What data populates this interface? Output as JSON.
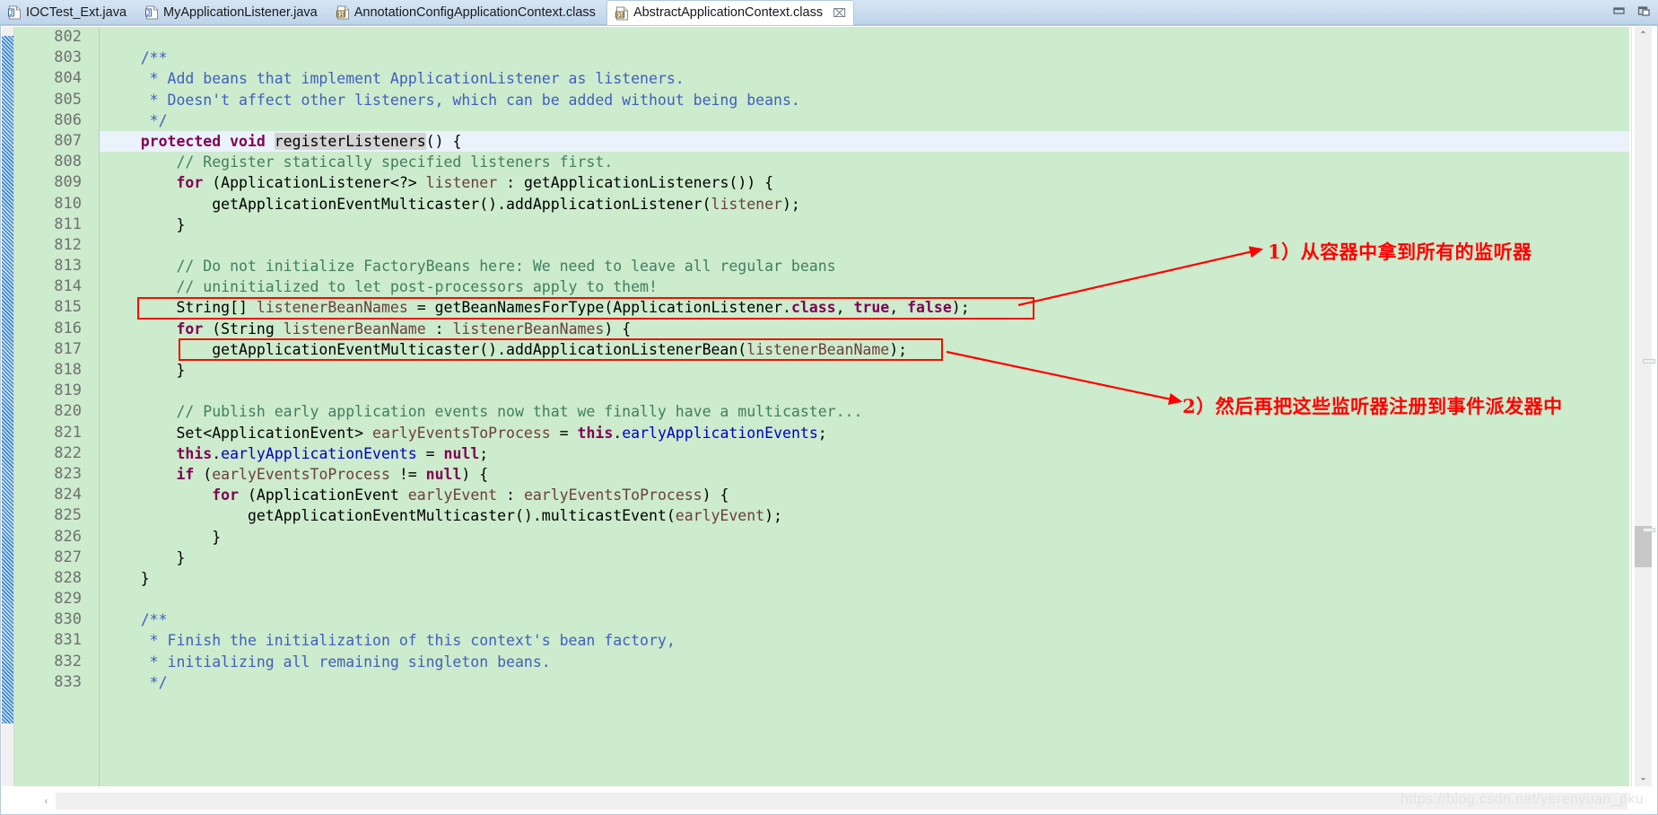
{
  "window": {
    "minimize_label": "minimize-window",
    "restore_label": "restore-window"
  },
  "tabs": [
    {
      "label": "IOCTest_Ext.java",
      "icon": "java-file-icon",
      "active": false,
      "closable": false
    },
    {
      "label": "MyApplicationListener.java",
      "icon": "java-file-icon",
      "active": false,
      "closable": false
    },
    {
      "label": "AnnotationConfigApplicationContext.class",
      "icon": "class-file-icon",
      "active": false,
      "closable": false
    },
    {
      "label": "AbstractApplicationContext.class",
      "icon": "class-file-icon",
      "active": true,
      "closable": true,
      "close_glyph": "⌧"
    }
  ],
  "editor": {
    "first_line": 802,
    "current_line": 807,
    "fold_lines": [
      803,
      807,
      830
    ],
    "lines": [
      {
        "n": 802,
        "tokens": []
      },
      {
        "n": 803,
        "tokens": [
          {
            "t": "    /**",
            "c": "jd"
          }
        ]
      },
      {
        "n": 804,
        "tokens": [
          {
            "t": "     * Add beans that implement ApplicationListener as listeners.",
            "c": "jd"
          }
        ]
      },
      {
        "n": 805,
        "tokens": [
          {
            "t": "     * Doesn't affect other listeners, which can be added without being beans.",
            "c": "jd"
          }
        ]
      },
      {
        "n": 806,
        "tokens": [
          {
            "t": "     */",
            "c": "jd"
          }
        ]
      },
      {
        "n": 807,
        "tokens": [
          {
            "t": "    ",
            "c": "pl"
          },
          {
            "t": "protected void ",
            "c": "k"
          },
          {
            "t": "registerListeners",
            "c": "pl occ"
          },
          {
            "t": "() {",
            "c": "pl"
          }
        ]
      },
      {
        "n": 808,
        "tokens": [
          {
            "t": "        // Register statically specified listeners first.",
            "c": "cm"
          }
        ]
      },
      {
        "n": 809,
        "tokens": [
          {
            "t": "        ",
            "c": "pl"
          },
          {
            "t": "for",
            "c": "k"
          },
          {
            "t": " (ApplicationListener<?> ",
            "c": "pl"
          },
          {
            "t": "listener",
            "c": "lv"
          },
          {
            "t": " : getApplicationListeners()) {",
            "c": "pl"
          }
        ]
      },
      {
        "n": 810,
        "tokens": [
          {
            "t": "            getApplicationEventMulticaster().addApplicationListener(",
            "c": "pl"
          },
          {
            "t": "listener",
            "c": "lv"
          },
          {
            "t": ");",
            "c": "pl"
          }
        ]
      },
      {
        "n": 811,
        "tokens": [
          {
            "t": "        }",
            "c": "pl"
          }
        ]
      },
      {
        "n": 812,
        "tokens": []
      },
      {
        "n": 813,
        "tokens": [
          {
            "t": "        // Do not initialize FactoryBeans here: We need to leave all regular beans",
            "c": "cm"
          }
        ]
      },
      {
        "n": 814,
        "tokens": [
          {
            "t": "        // uninitialized to let post-processors apply to them!",
            "c": "cm"
          }
        ]
      },
      {
        "n": 815,
        "tokens": [
          {
            "t": "        String[] ",
            "c": "pl"
          },
          {
            "t": "listenerBeanNames",
            "c": "lv"
          },
          {
            "t": " = getBeanNamesForType(ApplicationListener.",
            "c": "pl"
          },
          {
            "t": "class",
            "c": "k"
          },
          {
            "t": ", ",
            "c": "pl"
          },
          {
            "t": "true",
            "c": "k"
          },
          {
            "t": ", ",
            "c": "pl"
          },
          {
            "t": "false",
            "c": "k"
          },
          {
            "t": ");",
            "c": "pl"
          }
        ]
      },
      {
        "n": 816,
        "tokens": [
          {
            "t": "        ",
            "c": "pl"
          },
          {
            "t": "for",
            "c": "k"
          },
          {
            "t": " (String ",
            "c": "pl"
          },
          {
            "t": "listenerBeanName",
            "c": "lv"
          },
          {
            "t": " : ",
            "c": "pl"
          },
          {
            "t": "listenerBeanNames",
            "c": "lv"
          },
          {
            "t": ") {",
            "c": "pl"
          }
        ]
      },
      {
        "n": 817,
        "tokens": [
          {
            "t": "            getApplicationEventMulticaster().addApplicationListenerBean(",
            "c": "pl"
          },
          {
            "t": "listenerBeanName",
            "c": "lv"
          },
          {
            "t": ");",
            "c": "pl"
          }
        ]
      },
      {
        "n": 818,
        "tokens": [
          {
            "t": "        }",
            "c": "pl"
          }
        ]
      },
      {
        "n": 819,
        "tokens": []
      },
      {
        "n": 820,
        "tokens": [
          {
            "t": "        // Publish early application events now that we finally have a multicaster...",
            "c": "cm"
          }
        ]
      },
      {
        "n": 821,
        "tokens": [
          {
            "t": "        Set<ApplicationEvent> ",
            "c": "pl"
          },
          {
            "t": "earlyEventsToProcess",
            "c": "lv"
          },
          {
            "t": " = ",
            "c": "pl"
          },
          {
            "t": "this",
            "c": "k"
          },
          {
            "t": ".",
            "c": "pl"
          },
          {
            "t": "earlyApplicationEvents",
            "c": "fld"
          },
          {
            "t": ";",
            "c": "pl"
          }
        ]
      },
      {
        "n": 822,
        "tokens": [
          {
            "t": "        ",
            "c": "pl"
          },
          {
            "t": "this",
            "c": "k"
          },
          {
            "t": ".",
            "c": "pl"
          },
          {
            "t": "earlyApplicationEvents",
            "c": "fld"
          },
          {
            "t": " = ",
            "c": "pl"
          },
          {
            "t": "null",
            "c": "k"
          },
          {
            "t": ";",
            "c": "pl"
          }
        ]
      },
      {
        "n": 823,
        "tokens": [
          {
            "t": "        ",
            "c": "pl"
          },
          {
            "t": "if",
            "c": "k"
          },
          {
            "t": " (",
            "c": "pl"
          },
          {
            "t": "earlyEventsToProcess",
            "c": "lv"
          },
          {
            "t": " != ",
            "c": "pl"
          },
          {
            "t": "null",
            "c": "k"
          },
          {
            "t": ") {",
            "c": "pl"
          }
        ]
      },
      {
        "n": 824,
        "tokens": [
          {
            "t": "            ",
            "c": "pl"
          },
          {
            "t": "for",
            "c": "k"
          },
          {
            "t": " (ApplicationEvent ",
            "c": "pl"
          },
          {
            "t": "earlyEvent",
            "c": "lv"
          },
          {
            "t": " : ",
            "c": "pl"
          },
          {
            "t": "earlyEventsToProcess",
            "c": "lv"
          },
          {
            "t": ") {",
            "c": "pl"
          }
        ]
      },
      {
        "n": 825,
        "tokens": [
          {
            "t": "                getApplicationEventMulticaster().multicastEvent(",
            "c": "pl"
          },
          {
            "t": "earlyEvent",
            "c": "lv"
          },
          {
            "t": ");",
            "c": "pl"
          }
        ]
      },
      {
        "n": 826,
        "tokens": [
          {
            "t": "            }",
            "c": "pl"
          }
        ]
      },
      {
        "n": 827,
        "tokens": [
          {
            "t": "        }",
            "c": "pl"
          }
        ]
      },
      {
        "n": 828,
        "tokens": [
          {
            "t": "    }",
            "c": "pl"
          }
        ]
      },
      {
        "n": 829,
        "tokens": []
      },
      {
        "n": 830,
        "tokens": [
          {
            "t": "    /**",
            "c": "jd"
          }
        ]
      },
      {
        "n": 831,
        "tokens": [
          {
            "t": "     * Finish the initialization of this context's bean factory,",
            "c": "jd"
          }
        ]
      },
      {
        "n": 832,
        "tokens": [
          {
            "t": "     * initializing all remaining singleton beans.",
            "c": "jd"
          }
        ]
      },
      {
        "n": 833,
        "tokens": [
          {
            "t": "     */",
            "c": "jd"
          }
        ]
      }
    ]
  },
  "annotations": {
    "color": "#ff0000",
    "notes": [
      {
        "id": "note-1",
        "text": "1）从容器中拿到所有的监听器"
      },
      {
        "id": "note-2",
        "text": "2）然后再把这些监听器注册到事件派发器中"
      }
    ],
    "highlight_boxes": [
      {
        "id": "highlight-box-line-815"
      },
      {
        "id": "highlight-box-line-817"
      }
    ]
  },
  "scrollbars": {
    "vertical_up_glyph": "⌃",
    "vertical_down_glyph": "⌄",
    "horizontal_left_glyph": "‹"
  },
  "watermark": {
    "text": "https://blog.csdn.net/yerenyuan_pku"
  }
}
